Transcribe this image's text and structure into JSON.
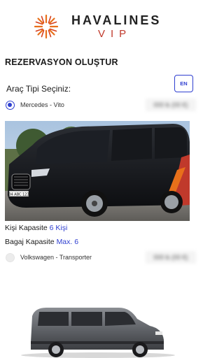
{
  "brand": {
    "name": "HAVALINES",
    "sub": "VIP"
  },
  "page": {
    "title": "REZERVASYON OLUŞTUR"
  },
  "lang_button": {
    "label": "EN"
  },
  "vehicle_type": {
    "label": "Araç Tipi Seçiniz:"
  },
  "options": [
    {
      "label": "Mercedes - Vito",
      "price": "000 ₺ (00 €)",
      "selected": true
    },
    {
      "label": "Volkswagen - Transporter",
      "price": "000 ₺ (00 €)",
      "selected": false
    }
  ],
  "vito": {
    "plate": "34 ABC 123",
    "person_label": "Kişi Kapasite",
    "person_value": "6 Kişi",
    "luggage_label": "Bagaj Kapasite",
    "luggage_value": "Max. 6"
  },
  "colors": {
    "accent": "#2f3fd0",
    "brand_red": "#c0392b",
    "logo_orange": "#e8701a"
  }
}
